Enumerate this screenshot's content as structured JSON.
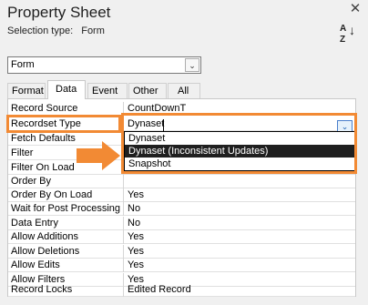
{
  "window": {
    "title": "Property Sheet",
    "close_glyph": "✕"
  },
  "selection": {
    "label": "Selection type:",
    "value": "Form"
  },
  "sort_icon": {
    "top": "A",
    "bottom": "Z",
    "arrow": "↓"
  },
  "object_combo": {
    "value": "Form",
    "chevron": "⌄"
  },
  "tabs": [
    {
      "label": "Format",
      "active": false
    },
    {
      "label": "Data",
      "active": true
    },
    {
      "label": "Event",
      "active": false
    },
    {
      "label": "Other",
      "active": false
    },
    {
      "label": "All",
      "active": false
    }
  ],
  "properties": [
    {
      "name": "Record Source",
      "value": "CountDownT"
    },
    {
      "name": "Recordset Type",
      "value": "Dynaset"
    },
    {
      "name": "Fetch Defaults",
      "value": ""
    },
    {
      "name": "Filter",
      "value": ""
    },
    {
      "name": "Filter On Load",
      "value": ""
    },
    {
      "name": "Order By",
      "value": ""
    },
    {
      "name": "Order By On Load",
      "value": "Yes"
    },
    {
      "name": "Wait for Post Processing",
      "value": "No"
    },
    {
      "name": "Data Entry",
      "value": "No"
    },
    {
      "name": "Allow Additions",
      "value": "Yes"
    },
    {
      "name": "Allow Deletions",
      "value": "Yes"
    },
    {
      "name": "Allow Edits",
      "value": "Yes"
    },
    {
      "name": "Allow Filters",
      "value": "Yes"
    },
    {
      "name": "Record Locks",
      "value": "Edited Record"
    }
  ],
  "dropdown": {
    "chevron": "⌄",
    "options": [
      "Dynaset",
      "Dynaset (Inconsistent Updates)",
      "Snapshot"
    ],
    "highlighted": "Dynaset (Inconsistent Updates)"
  },
  "colors": {
    "callout": "#f28a34",
    "highlight_bg": "#1f1f1f"
  }
}
